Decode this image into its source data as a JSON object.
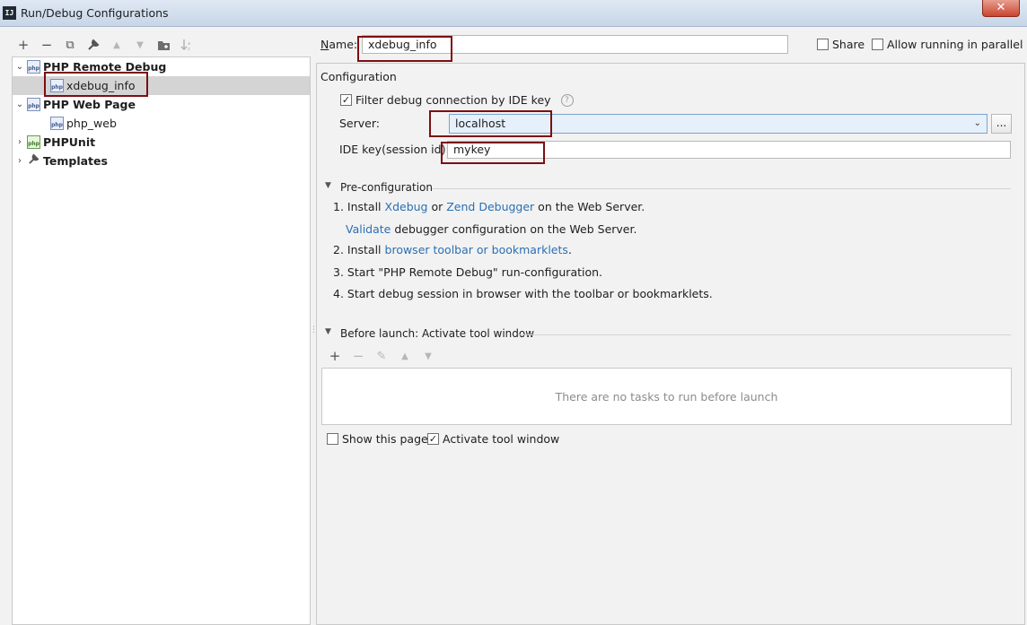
{
  "window": {
    "title": "Run/Debug Configurations",
    "app_icon": "IJ",
    "close_glyph": "✕"
  },
  "toolbar": {
    "add": "+",
    "remove": "−",
    "copy": "⧉",
    "edit": "🔧",
    "up": "▲",
    "down": "▼",
    "folder": "📁",
    "sort": "↓"
  },
  "tree": {
    "items": [
      {
        "label": "PHP Remote Debug",
        "icon": "php-remote-debug-icon",
        "expanded": true
      },
      {
        "label": "xdebug_info",
        "icon": "php-remote-debug-icon",
        "selected": true
      },
      {
        "label": "PHP Web Page",
        "icon": "php-web-page-icon",
        "expanded": true
      },
      {
        "label": "php_web",
        "icon": "php-web-page-icon"
      },
      {
        "label": "PHPUnit",
        "icon": "phpunit-icon",
        "expanded": false
      },
      {
        "label": "Templates",
        "icon": "wrench-icon",
        "expanded": false
      }
    ]
  },
  "header": {
    "name_label": "Name:",
    "name_value": "xdebug_info",
    "share_label": "Share",
    "share_checked": false,
    "parallel_label": "Allow running in parallel",
    "parallel_checked": false
  },
  "configuration": {
    "section_title": "Configuration",
    "filter_label": "Filter debug connection by IDE key",
    "filter_checked": true,
    "help_glyph": "?",
    "server_label": "Server:",
    "server_value": "localhost",
    "ellipsis": "...",
    "ide_key_label": "IDE key(session id):",
    "ide_key_value": "mykey"
  },
  "preconfig": {
    "title": "Pre-configuration",
    "step1_prefix": "1. Install ",
    "xdebug_link": "Xdebug",
    "or_text": " or ",
    "zend_link": "Zend Debugger",
    "step1_suffix": " on the Web Server.",
    "validate_link": "Validate",
    "validate_suffix": " debugger configuration on the Web Server.",
    "step2_prefix": "2. Install ",
    "toolbar_link": "browser toolbar or bookmarklets",
    "step2_suffix": ".",
    "step3": "3. Start \"PHP Remote Debug\" run-configuration.",
    "step4": "4. Start debug session in browser with the toolbar or bookmarklets."
  },
  "before_launch": {
    "title": "Before launch: Activate tool window",
    "empty_text": "There are no tasks to run before launch",
    "tools": {
      "add": "+",
      "remove": "−",
      "edit": "✎",
      "up": "▲",
      "down": "▼"
    }
  },
  "footer": {
    "show_page_label": "Show this page",
    "show_page_checked": false,
    "activate_label": "Activate tool window",
    "activate_checked": true
  },
  "colors": {
    "highlight_box": "#7c0f10",
    "link": "#2a6fb4",
    "selection": "#d4d4d4"
  }
}
